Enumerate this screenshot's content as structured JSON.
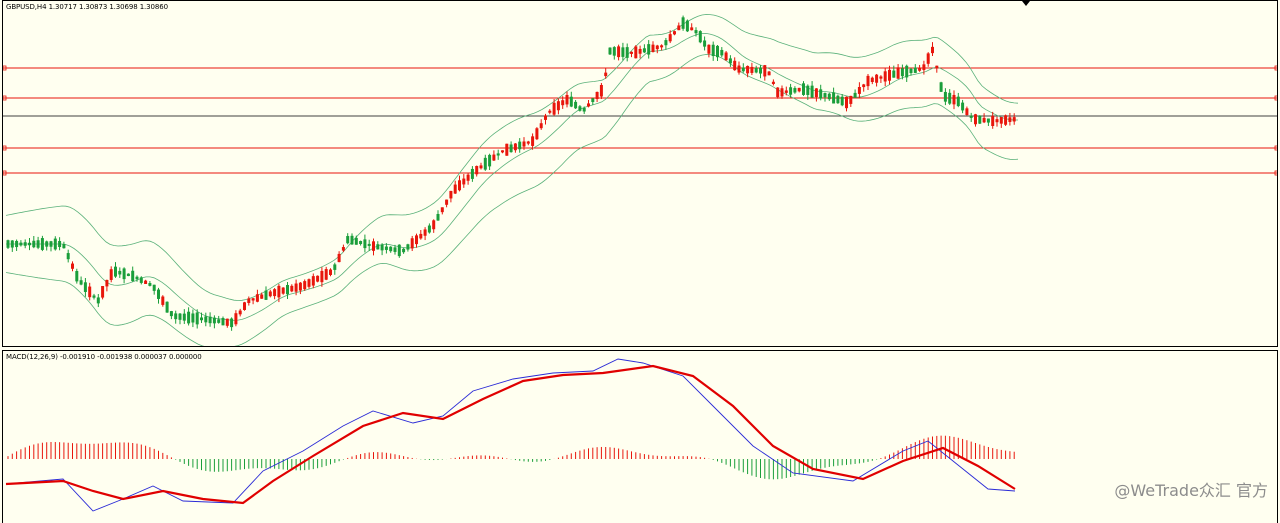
{
  "main_chart": {
    "header": "GBPUSD,H4  1.30717 1.30873 1.30698 1.30860",
    "colors": {
      "background": "#fffff0",
      "bull": "#e8160c",
      "bear": "#1a9e3a",
      "bands": "#5ab17a",
      "level_lines": "#e8160c",
      "current_line": "#404040"
    },
    "horizontal_levels": [
      1,
      2,
      4,
      5
    ],
    "current_level": 3
  },
  "macd": {
    "header": "MACD(12,26,9) -0.001910 -0.001938 0.000037 0.000000",
    "colors": {
      "macd_line": "#2b2bd6",
      "signal_line": "#e00000",
      "hist_pos": "#e8160c",
      "hist_neg": "#1a9e3a"
    }
  },
  "watermark": "@WeTrade众汇 官方"
}
